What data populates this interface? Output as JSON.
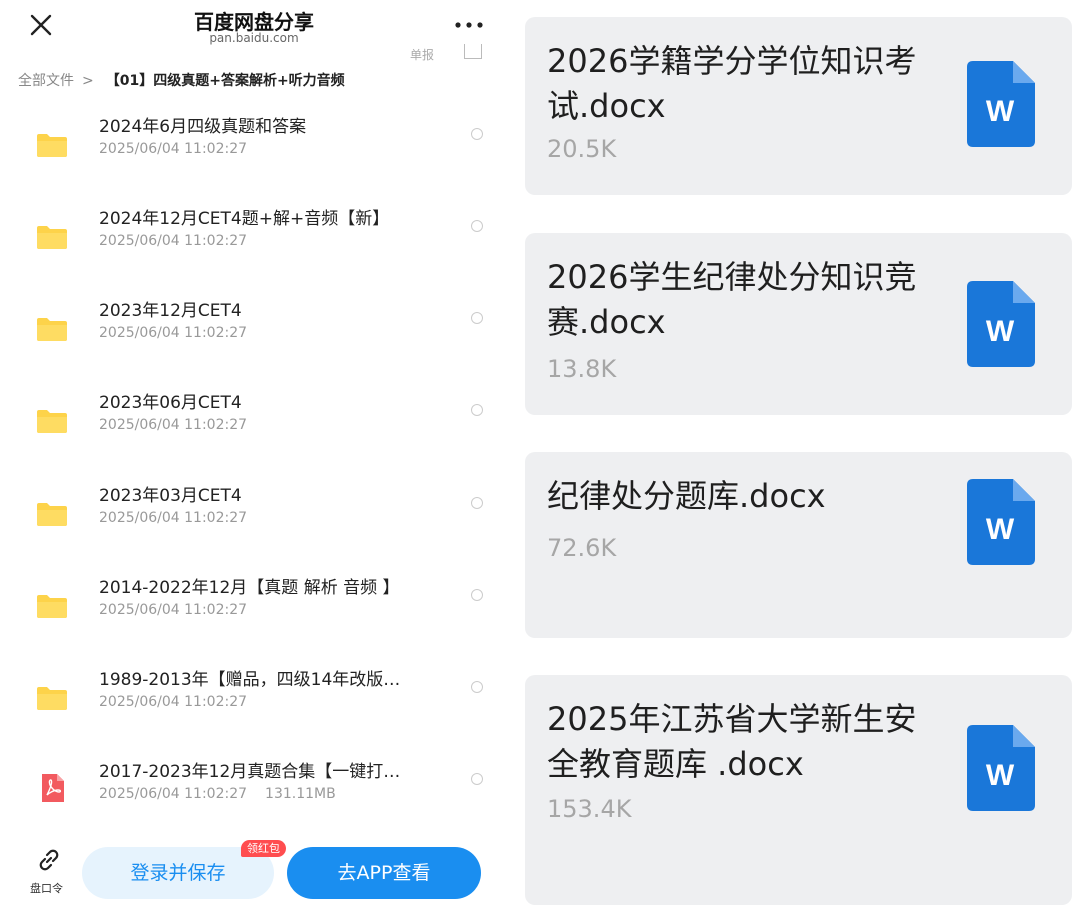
{
  "left": {
    "header": {
      "title": "百度网盘分享",
      "url": "pan.baidu.com",
      "sort_label": "单报"
    },
    "breadcrumb": {
      "root": "全部文件",
      "separator": ">",
      "current": "【01】四级真题+答案解析+听力音频"
    },
    "files": [
      {
        "name": "2024年6月四级真题和答案",
        "date": "2025/06/04 11:02:27",
        "size": "",
        "type": "folder"
      },
      {
        "name": "2024年12月CET4题+解+音频【新】",
        "date": "2025/06/04 11:02:27",
        "size": "",
        "type": "folder"
      },
      {
        "name": "2023年12月CET4",
        "date": "2025/06/04 11:02:27",
        "size": "",
        "type": "folder"
      },
      {
        "name": "2023年06月CET4",
        "date": "2025/06/04 11:02:27",
        "size": "",
        "type": "folder"
      },
      {
        "name": "2023年03月CET4",
        "date": "2025/06/04 11:02:27",
        "size": "",
        "type": "folder"
      },
      {
        "name": "2014-2022年12月【真题 解析 音频 】",
        "date": "2025/06/04 11:02:27",
        "size": "",
        "type": "folder"
      },
      {
        "name": "1989-2013年【赠品，四级14年改版…",
        "date": "2025/06/04 11:02:27",
        "size": "",
        "type": "folder"
      },
      {
        "name": "2017-2023年12月真题合集【一键打…",
        "date": "2025/06/04 11:02:27",
        "size": "131.11MB",
        "type": "pdf"
      }
    ],
    "bottom": {
      "link_label": "盘口令",
      "save_button": "登录并保存",
      "badge": "领红包",
      "app_button": "去APP查看"
    }
  },
  "right": {
    "docs": [
      {
        "name": "2026学籍学分学位知识考试.docx",
        "size": "20.5K",
        "icon_letter": "W"
      },
      {
        "name": "2026学生纪律处分知识竞赛.docx",
        "size": "13.8K",
        "icon_letter": "W"
      },
      {
        "name": "纪律处分题库.docx",
        "size": "72.6K",
        "icon_letter": "W"
      },
      {
        "name": "2025年江苏省大学新生安全教育题库 .docx",
        "size": "153.4K",
        "icon_letter": "W"
      }
    ]
  },
  "colors": {
    "accent": "#1a8ef0",
    "folder": "#fdd34a",
    "pdf": "#f25a5f",
    "word": "#1a77d9",
    "badge": "#ff4d4f"
  }
}
